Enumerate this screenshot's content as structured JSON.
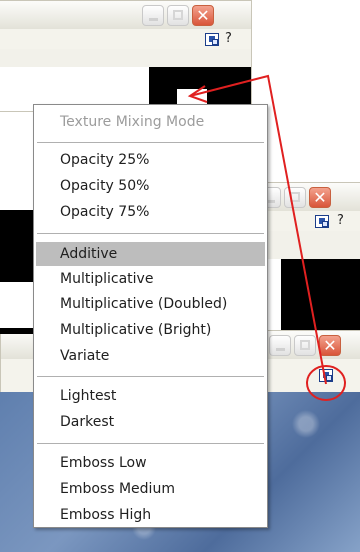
{
  "context_menu": {
    "title": "Texture Mixing Mode",
    "groups": [
      [
        "Opacity 25%",
        "Opacity 50%",
        "Opacity 75%"
      ],
      [
        "Additive",
        "Multiplicative",
        "Multiplicative (Doubled)",
        "Multiplicative (Bright)",
        "Variate"
      ],
      [
        "Lightest",
        "Darkest"
      ],
      [
        "Emboss Low",
        "Emboss Medium",
        "Emboss High"
      ]
    ],
    "highlighted": "Additive"
  },
  "windows": {
    "help_label": "?"
  },
  "annotation": {
    "arrow_color": "#e02020"
  },
  "icons": {
    "minimize": "minimize-icon",
    "maximize": "maximize-icon",
    "close": "close-icon",
    "mixing_mode": "texture-mixing-mode-icon"
  }
}
